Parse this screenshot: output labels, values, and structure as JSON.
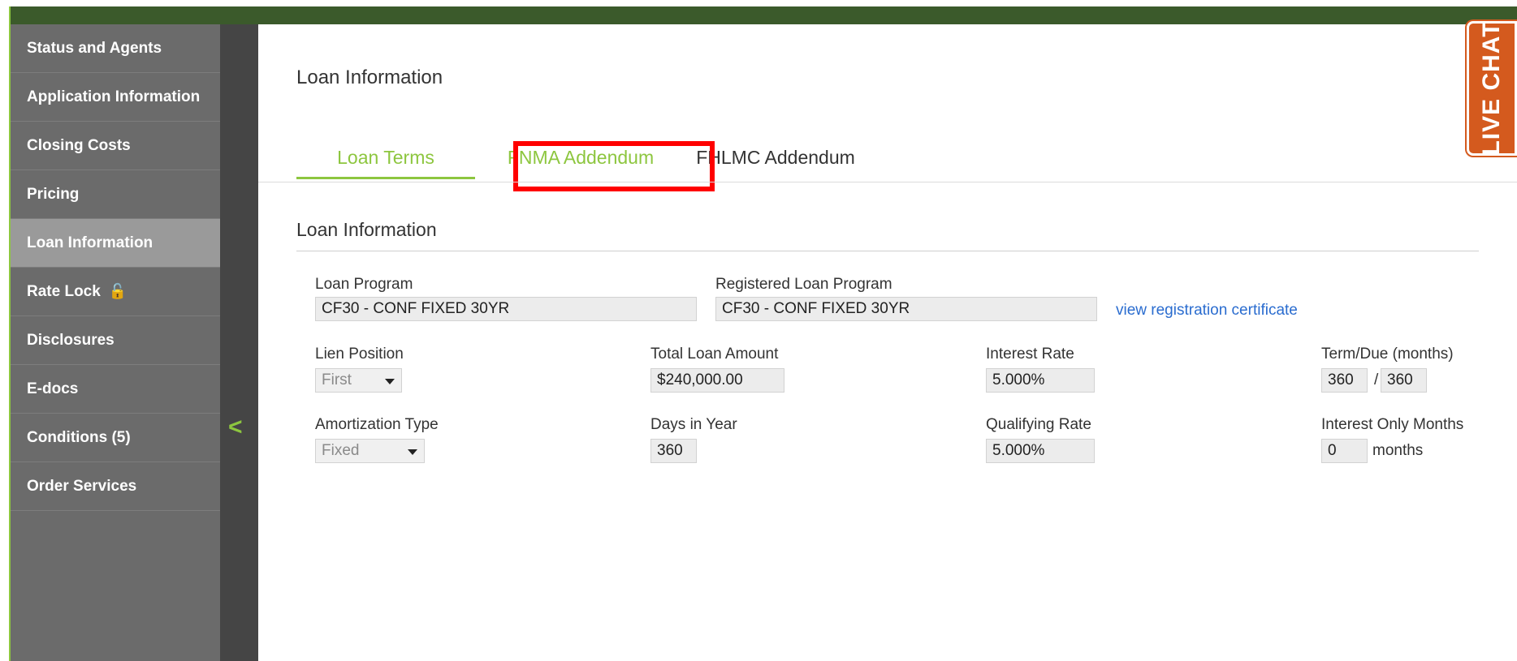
{
  "sidebar": {
    "items": [
      {
        "label": "Status and Agents"
      },
      {
        "label": "Application Information"
      },
      {
        "label": "Closing Costs"
      },
      {
        "label": "Pricing"
      },
      {
        "label": "Loan Information"
      },
      {
        "label": "Rate Lock"
      },
      {
        "label": "Disclosures"
      },
      {
        "label": "E-docs"
      },
      {
        "label": "Conditions (5)"
      },
      {
        "label": "Order Services"
      }
    ],
    "active": "Loan Information"
  },
  "collapse": {
    "icon": "chevron-left-icon",
    "glyph": "<"
  },
  "page": {
    "title": "Loan Information"
  },
  "tabs": [
    {
      "label": "Loan Terms"
    },
    {
      "label": "FNMA Addendum"
    },
    {
      "label": "FHLMC Addendum"
    }
  ],
  "section": {
    "title": "Loan Information"
  },
  "form": {
    "loan_program": {
      "label": "Loan Program",
      "value": "CF30 - CONF FIXED 30YR"
    },
    "registered_loan_program": {
      "label": "Registered Loan Program",
      "value": "CF30 - CONF FIXED 30YR"
    },
    "view_certificate": "view registration certificate",
    "lien_position": {
      "label": "Lien Position",
      "value": "First"
    },
    "total_loan_amount": {
      "label": "Total Loan Amount",
      "value": "$240,000.00"
    },
    "interest_rate": {
      "label": "Interest Rate",
      "value": "5.000%"
    },
    "term_due": {
      "label": "Term/Due (months)",
      "term": "360",
      "separator": "/",
      "due": "360"
    },
    "amortization_type": {
      "label": "Amortization Type",
      "value": "Fixed"
    },
    "days_in_year": {
      "label": "Days in Year",
      "value": "360"
    },
    "qualifying_rate": {
      "label": "Qualifying Rate",
      "value": "5.000%"
    },
    "interest_only_months": {
      "label": "Interest Only Months",
      "value": "0",
      "unit": "months"
    }
  },
  "live_chat": {
    "label": "LIVE CHAT"
  },
  "colors": {
    "accent": "#8dc63f",
    "sidebar": "#6b6b6b",
    "highlight": "#ff0000",
    "link": "#2a6ccf",
    "chat": "#d45a1e"
  }
}
